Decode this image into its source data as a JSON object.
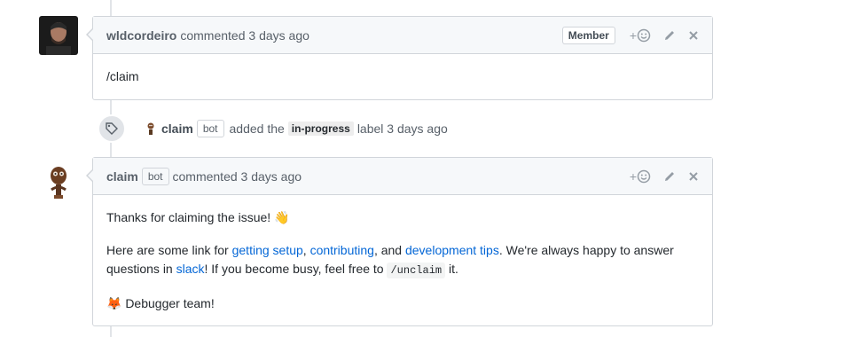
{
  "comment1": {
    "author": "wldcordeiro",
    "action_text": "commented 3 days ago",
    "role_badge": "Member",
    "add_reaction": "+",
    "body": "/claim"
  },
  "event": {
    "author": "claim",
    "bot_badge": "bot",
    "text_before": "added the",
    "label": "in-progress",
    "text_after": "label 3 days ago"
  },
  "comment2": {
    "author": "claim",
    "bot_badge": "bot",
    "action_text": "commented 3 days ago",
    "add_reaction": "+",
    "para1": "Thanks for claiming the issue! 👋",
    "para2": {
      "t1": "Here are some link for ",
      "link1": "getting setup",
      "t2": ", ",
      "link2": "contributing",
      "t3": ", and ",
      "link3": "development tips",
      "t4": ". We're always happy to answer questions in ",
      "link4": "slack",
      "t5": "! If you become busy, feel free to ",
      "code": "/unclaim",
      "t6": " it."
    },
    "para3": "🦊 Debugger team!"
  },
  "icons": [
    "smiley-icon",
    "pencil-icon",
    "close-icon",
    "tag-icon"
  ],
  "colors": {
    "link": "#0366d6",
    "header_bg": "#f6f8fa",
    "border": "#d1d5da"
  }
}
